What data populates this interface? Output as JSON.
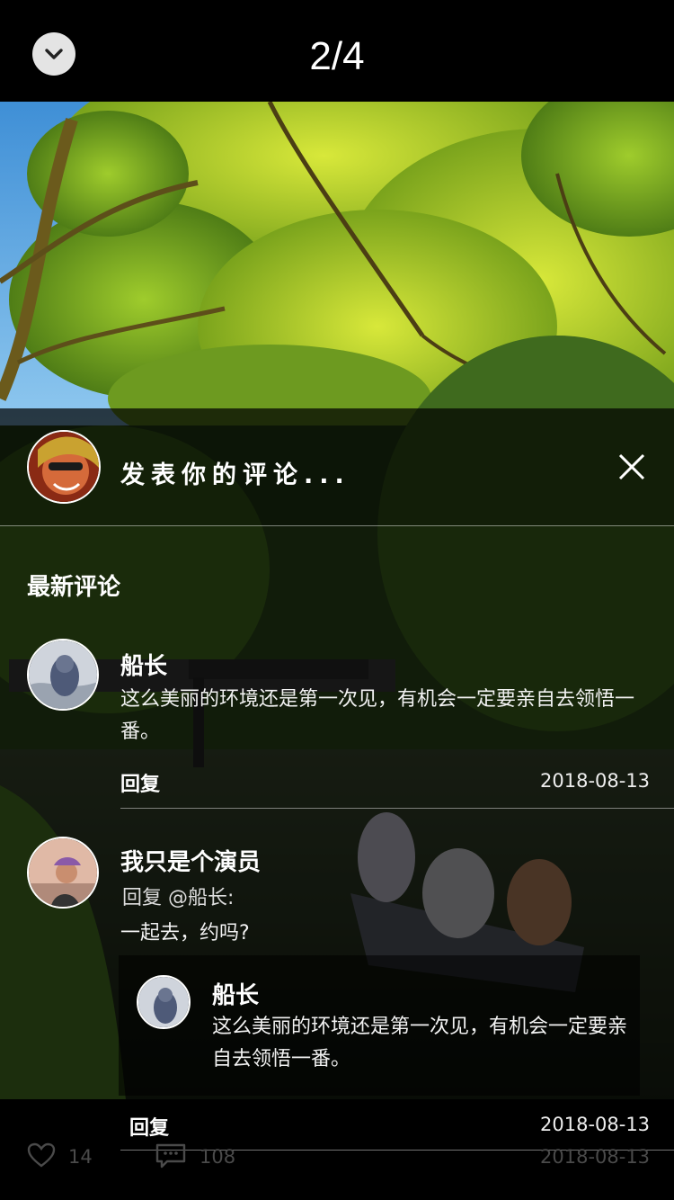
{
  "header": {
    "page_indicator": "2/4",
    "collapse_icon": "chevron-down-icon"
  },
  "compose": {
    "placeholder": "发表你的评论...",
    "close_icon": "close-icon"
  },
  "section_title": "最新评论",
  "comments": [
    {
      "author": "船长",
      "text": "这么美丽的环境还是第一次见，有机会一定要亲自去领悟一番。",
      "reply_label": "回复",
      "date": "2018-08-13"
    },
    {
      "author": "我只是个演员",
      "reply_to": "回复 @船长:",
      "text": "一起去，约吗?",
      "quoted": {
        "author": "船长",
        "text": "这么美丽的环境还是第一次见，有机会一定要亲自去领悟一番。"
      },
      "reply_label": "回复",
      "date": "2018-08-13"
    }
  ],
  "footer": {
    "likes": "14",
    "comments": "108",
    "date": "2018-08-13",
    "like_icon": "heart-icon",
    "comment_icon": "comment-icon"
  }
}
